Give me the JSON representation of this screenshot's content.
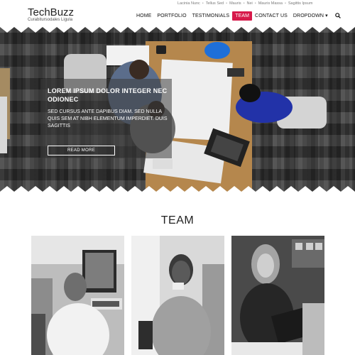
{
  "header": {
    "logo_title": "TechBuzz",
    "logo_subtitle": "Curabitursodales Ligula",
    "topbar_links": [
      "Lacinia Nunc",
      "Tellus Sed",
      "Mauris",
      "Nei",
      "Mauris Massa",
      "Sagittis Ipsum"
    ],
    "nav": [
      {
        "label": "HOME"
      },
      {
        "label": "PORTFOLIO"
      },
      {
        "label": "TESTIMONIALS"
      },
      {
        "label": "TEAM"
      },
      {
        "label": "CONTACT US"
      },
      {
        "label": "DROPDOWN ▾"
      }
    ],
    "active_nav": "TEAM",
    "search_icon": "search-icon"
  },
  "hero": {
    "title": "LOREM IPSUM DOLOR INTEGER NEC ODIONEC",
    "body": "SED CURSUS ANTE DAPIBUS DIAM. SED NULLA QUIS SEM AT NIBH ELEMENTUM IMPERDIET. DUIS SAGITTIS",
    "button_label": "READ MORE"
  },
  "team": {
    "title": "TEAM",
    "members": [
      {
        "photo": "team-photo-1"
      },
      {
        "photo": "team-photo-2"
      },
      {
        "photo": "team-photo-3"
      }
    ]
  },
  "colors": {
    "accent": "#d7194a",
    "text": "#222222"
  }
}
